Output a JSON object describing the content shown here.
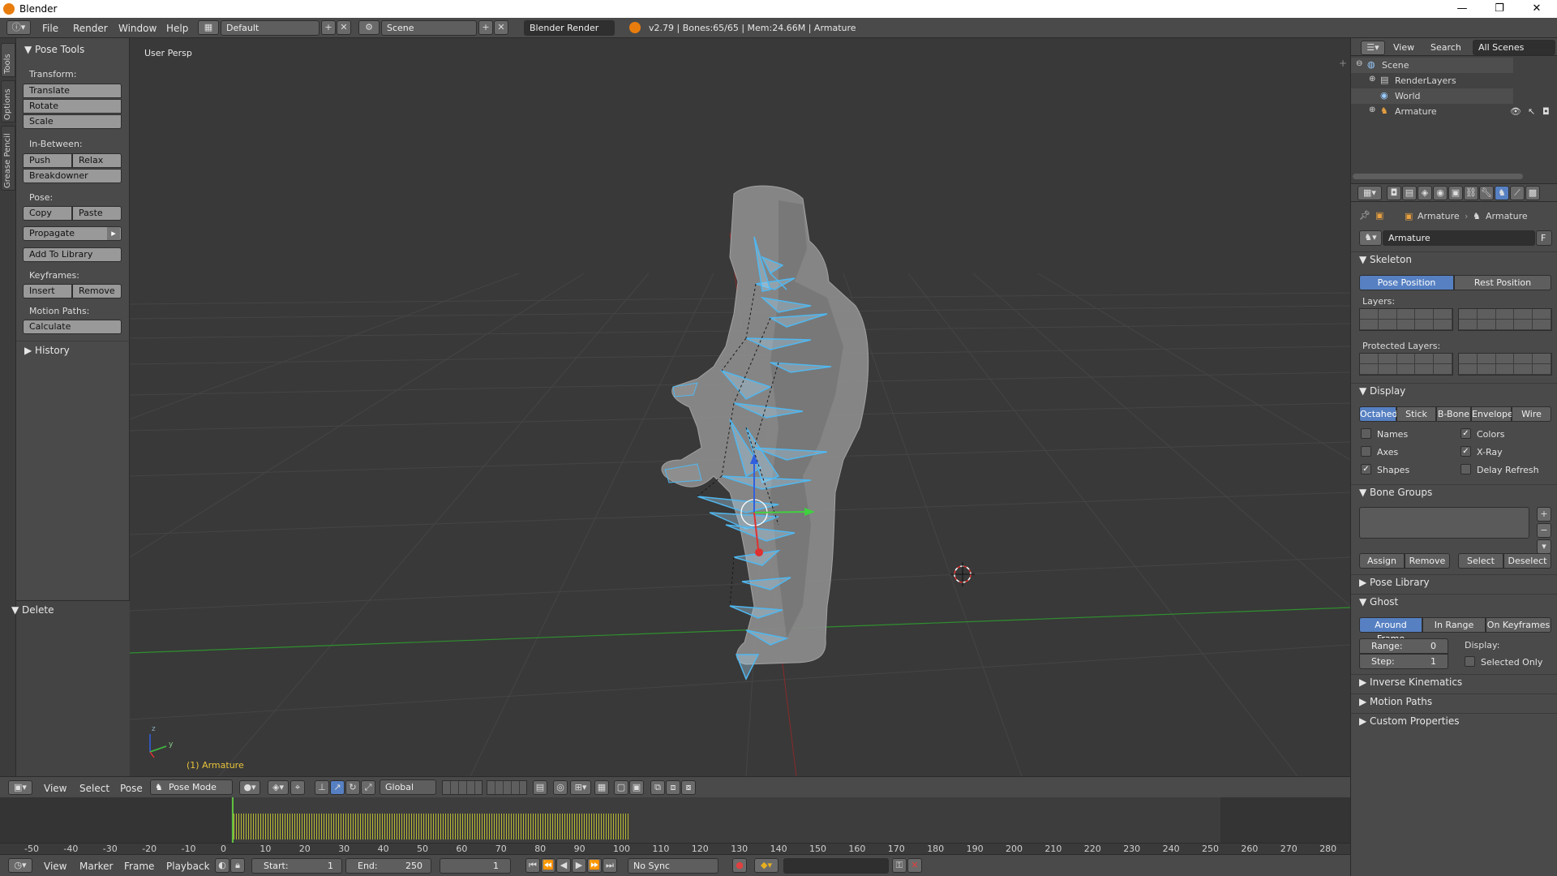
{
  "window": {
    "title": "Blender",
    "minimize": "—",
    "restore": "❐",
    "close": "✕"
  },
  "info_header": {
    "menu": [
      "File",
      "Render",
      "Window",
      "Help"
    ],
    "layout": "Default",
    "scene": "Scene",
    "engine": "Blender Render",
    "stats": "v2.79 | Bones:65/65 | Mem:24.66M | Armature"
  },
  "tool_tabs": [
    "Tools",
    "Options",
    "Grease Pencil"
  ],
  "tool_shelf": {
    "title": "Pose Tools",
    "transform_label": "Transform:",
    "translate": "Translate",
    "rotate": "Rotate",
    "scale": "Scale",
    "inbetween_label": "In-Between:",
    "push": "Push",
    "relax": "Relax",
    "breakdowner": "Breakdowner",
    "pose_label": "Pose:",
    "copy": "Copy",
    "paste": "Paste",
    "propagate": "Propagate",
    "add_to_library": "Add To Library",
    "keyframes_label": "Keyframes:",
    "insert": "Insert",
    "remove": "Remove",
    "motion_paths_label": "Motion Paths:",
    "calculate": "Calculate",
    "history": "History",
    "delete": "Delete"
  },
  "viewport": {
    "view_name": "User Persp",
    "object_label": "(1) Armature",
    "axis_y": "y",
    "axis_z": "z"
  },
  "view3d_header": {
    "menu": [
      "View",
      "Select",
      "Pose"
    ],
    "mode": "Pose Mode",
    "orientation": "Global"
  },
  "timeline": {
    "ticks": [
      "-50",
      "-40",
      "-30",
      "-20",
      "-10",
      "0",
      "10",
      "20",
      "30",
      "40",
      "50",
      "60",
      "70",
      "80",
      "90",
      "100",
      "110",
      "120",
      "130",
      "140",
      "150",
      "160",
      "170",
      "180",
      "190",
      "200",
      "210",
      "220",
      "230",
      "240",
      "250",
      "260",
      "270",
      "280"
    ],
    "menu": [
      "View",
      "Marker",
      "Frame",
      "Playback"
    ],
    "start_label": "Start:",
    "start": "1",
    "end_label": "End:",
    "end": "250",
    "current": "1",
    "sync": "No Sync",
    "colors": {
      "keys": "#b8b832",
      "cursor": "#60c040"
    }
  },
  "outliner": {
    "menu": [
      "View",
      "Search"
    ],
    "filter": "All Scenes",
    "items": [
      "Scene",
      "RenderLayers",
      "World",
      "Armature"
    ]
  },
  "properties": {
    "breadcrumb": [
      "Armature",
      "Armature"
    ],
    "datablock": "Armature",
    "fake_user": "F",
    "skeleton": {
      "title": "Skeleton",
      "pose_position": "Pose Position",
      "rest_position": "Rest Position",
      "layers_label": "Layers:",
      "protected_label": "Protected Layers:"
    },
    "display": {
      "title": "Display",
      "modes": [
        "Octahed",
        "Stick",
        "B-Bone",
        "Envelope",
        "Wire"
      ],
      "names": "Names",
      "colors": "Colors",
      "axes": "Axes",
      "xray": "X-Ray",
      "shapes": "Shapes",
      "delay_refresh": "Delay Refresh"
    },
    "bone_groups": {
      "title": "Bone Groups",
      "assign": "Assign",
      "remove": "Remove",
      "select": "Select",
      "deselect": "Deselect"
    },
    "pose_library": "Pose Library",
    "ghost": {
      "title": "Ghost",
      "modes": [
        "Around Frame",
        "In Range",
        "On Keyframes"
      ],
      "range_label": "Range:",
      "range": "0",
      "step_label": "Step:",
      "step": "1",
      "display_label": "Display:",
      "selected_only": "Selected Only"
    },
    "inverse_kinematics": "Inverse Kinematics",
    "motion_paths": "Motion Paths",
    "custom_properties": "Custom Properties"
  },
  "colors": {
    "accent": "#5680c2",
    "bone": "#4fb7f0",
    "grid": "#4a4a4a"
  }
}
